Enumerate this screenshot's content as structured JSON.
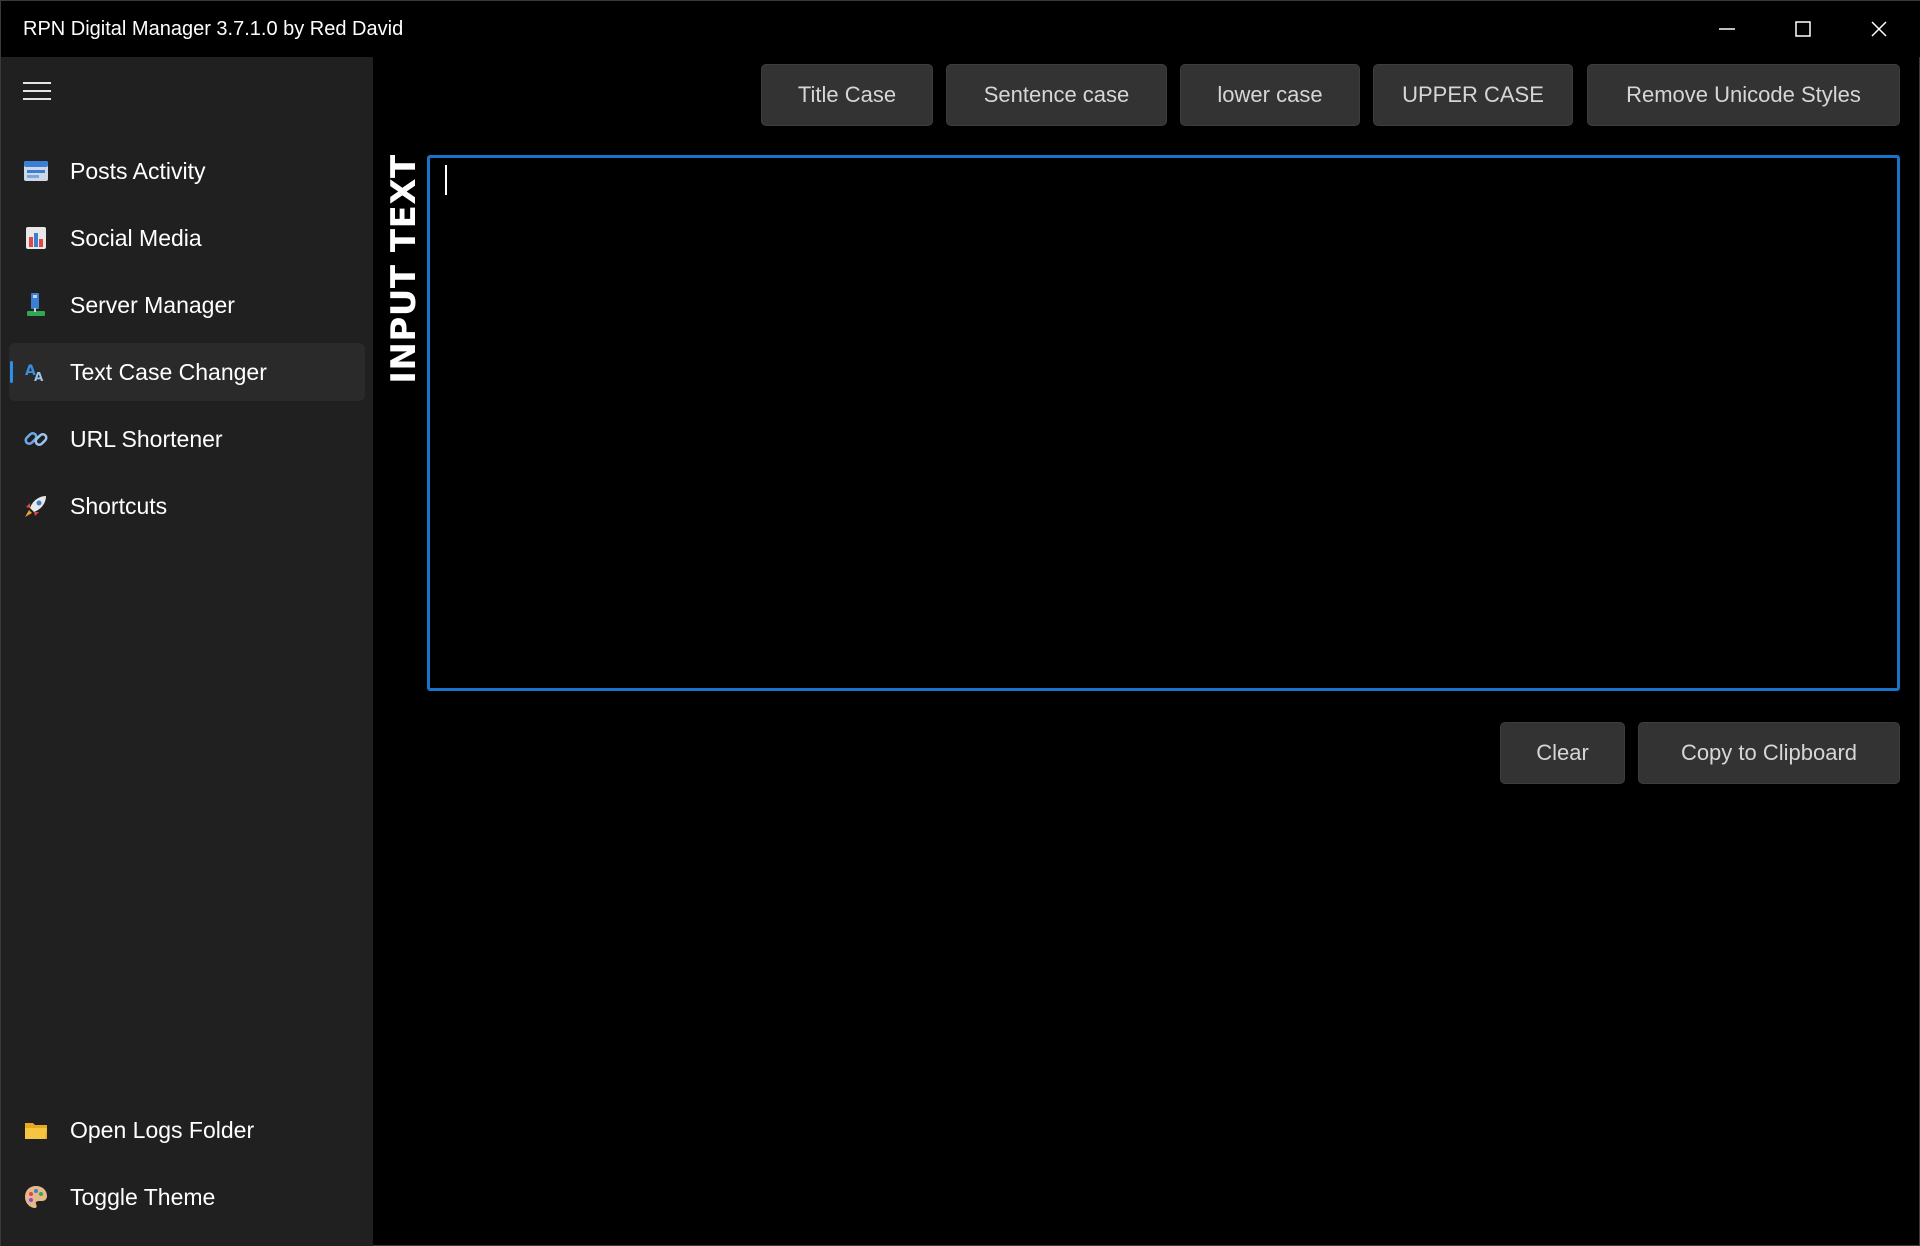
{
  "window": {
    "title": "RPN Digital Manager 3.7.1.0 by Red David"
  },
  "sidebar": {
    "items": [
      {
        "label": "Posts Activity",
        "icon": "posts-activity-icon"
      },
      {
        "label": "Social Media",
        "icon": "social-media-icon"
      },
      {
        "label": "Server Manager",
        "icon": "server-manager-icon"
      },
      {
        "label": "Text Case Changer",
        "icon": "text-case-icon",
        "selected": true
      },
      {
        "label": "URL Shortener",
        "icon": "link-icon"
      },
      {
        "label": "Shortcuts",
        "icon": "rocket-icon"
      }
    ],
    "footer_items": [
      {
        "label": "Open Logs Folder",
        "icon": "folder-icon"
      },
      {
        "label": "Toggle Theme",
        "icon": "palette-icon"
      }
    ]
  },
  "toolbar": {
    "title_case": "Title Case",
    "sentence_case": "Sentence case",
    "lower_case": "lower case",
    "upper_case": "UPPER CASE",
    "remove_unicode": "Remove Unicode Styles"
  },
  "editor": {
    "label": "INPUT TEXT",
    "value": ""
  },
  "actions": {
    "clear": "Clear",
    "copy": "Copy to Clipboard"
  },
  "colors": {
    "accent": "#1a73c9",
    "sidebar_bg": "#202020",
    "button_bg": "#333333",
    "window_bg": "#000000"
  }
}
